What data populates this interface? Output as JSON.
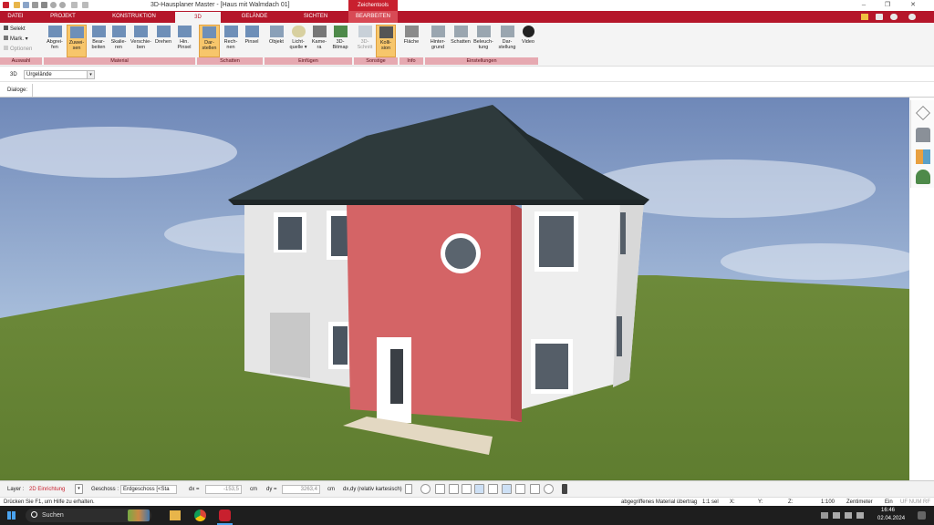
{
  "window": {
    "title": "3D-Hausplaner Master - [Haus mit Walmdach 01]",
    "context_tab": "Zeichentools",
    "buttons": [
      "─",
      "❐",
      "✕"
    ]
  },
  "tabs": [
    {
      "label": "DATEI"
    },
    {
      "label": "PROJEKT"
    },
    {
      "label": "KONSTRUKTION"
    },
    {
      "label": "3D"
    },
    {
      "label": "GELÄNDE"
    },
    {
      "label": "SICHTEN"
    },
    {
      "label": "BEARBEITEN"
    }
  ],
  "ribbon": {
    "auswahl": {
      "select": "Selekt",
      "mark": "Mark. ▾",
      "options": "Optionen",
      "group": "Auswahl"
    },
    "material": {
      "group": "Material",
      "buttons": [
        {
          "label": "Abgrei-\nfen"
        },
        {
          "label": "Zuwei-\nsen"
        },
        {
          "label": "Bear-\nbeiten"
        },
        {
          "label": "Skalie-\nren"
        },
        {
          "label": "Verschie-\nben"
        },
        {
          "label": "Drehen"
        },
        {
          "label": "Hin.\nPinsel"
        }
      ]
    },
    "schatten": {
      "group": "Schatten",
      "buttons": [
        {
          "label": "Dar-\nstellen"
        },
        {
          "label": "Rech-\nnen"
        },
        {
          "label": "Pinsel"
        }
      ]
    },
    "einfuegen": {
      "group": "Einfügen",
      "buttons": [
        {
          "label": "Objekt"
        },
        {
          "label": "Licht-\nquelle ▾"
        },
        {
          "label": "Kame-\nra"
        },
        {
          "label": "3D-\nBitmap"
        }
      ]
    },
    "sonstige": {
      "group": "Sonstige",
      "buttons": [
        {
          "label": "3D-\nSchnitt"
        },
        {
          "label": "Kolli-\nsion"
        }
      ]
    },
    "info": {
      "group": "Info",
      "buttons": [
        {
          "label": "Fläche"
        }
      ]
    },
    "einstellungen": {
      "group": "Einstellungen",
      "buttons": [
        {
          "label": "Hinter-\ngrund"
        },
        {
          "label": "Schatten"
        },
        {
          "label": "Beleuch-\ntung"
        },
        {
          "label": "Dar-\nstellung"
        },
        {
          "label": "Video"
        }
      ]
    }
  },
  "view_row": {
    "label": "3D",
    "select_value": "Urgelände"
  },
  "dialog_row": {
    "label": "Dialoge:"
  },
  "bottom_toolbar": {
    "layer_label": "Layer :",
    "layer_value": "2D Einrichtung",
    "geschoss_label": "Geschoss :",
    "geschoss_value": "Erdgeschoss [<Sta",
    "dx_label": "dx =",
    "dx_value": "-153,5",
    "dx_unit": "cm",
    "dy_label": "dy =",
    "dy_value": "3263,4",
    "dy_unit": "cm",
    "coord_mode": "dx,dy (relativ kartesisch)"
  },
  "status": {
    "hint": "Drücken Sie F1, um Hilfe zu erhalten.",
    "mode": "abgegriffenes Material übertrag",
    "sel": "1:1 sel",
    "x": "X:",
    "y": "Y:",
    "z": "Z:",
    "scale": "1:100",
    "unit": "Zentimeter",
    "state": "Ein",
    "flags": "UF NUM RF"
  },
  "taskbar": {
    "search_placeholder": "Suchen",
    "time": "16:46",
    "date": "02.04.2024"
  },
  "colors": {
    "ribbon_red": "#b5162a",
    "selected_button": "#f7c66b",
    "group_bar": "#e6a9b1",
    "house_red": "#d46466",
    "roof": "#2e3a3c",
    "grass": "#6f8f3b"
  }
}
